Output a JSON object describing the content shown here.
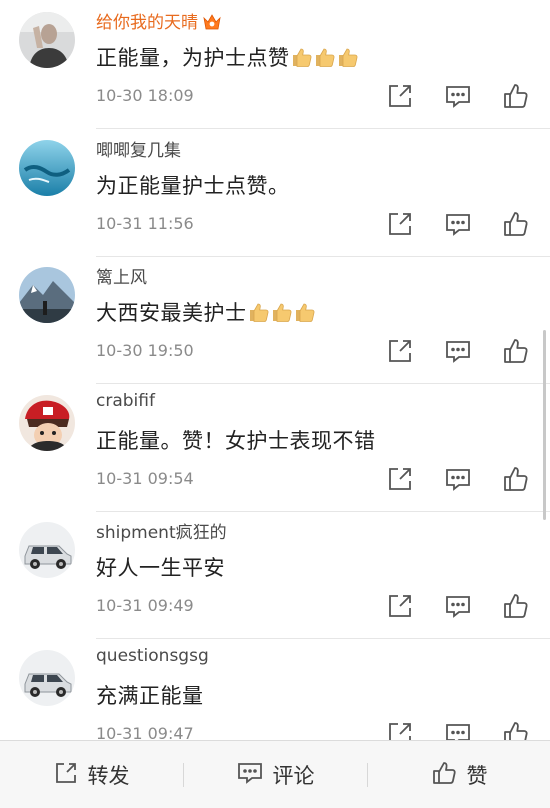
{
  "comments": [
    {
      "username": "给你我的天晴",
      "vip": true,
      "text": "正能量，为护士点赞",
      "thumbs": 3,
      "time": "10-30 18:09",
      "avatar": "man-gesture"
    },
    {
      "username": "唧唧复几集",
      "vip": false,
      "text": "为正能量护士点赞。",
      "thumbs": 0,
      "time": "10-31 11:56",
      "avatar": "water"
    },
    {
      "username": "篱上风",
      "vip": false,
      "text": "大西安最美护士",
      "thumbs": 3,
      "time": "10-30 19:50",
      "avatar": "mountain"
    },
    {
      "username": "crabifif",
      "vip": false,
      "text": "正能量。赞！女护士表现不错",
      "thumbs": 0,
      "time": "10-31 09:54",
      "avatar": "anime"
    },
    {
      "username": "shipment疯狂的",
      "vip": false,
      "text": "好人一生平安",
      "thumbs": 0,
      "time": "10-31 09:49",
      "avatar": "car"
    },
    {
      "username": "questionsgsg",
      "vip": false,
      "text": "充满正能量",
      "thumbs": 0,
      "time": "10-31 09:47",
      "avatar": "car"
    }
  ],
  "bottom_bar": {
    "repost_label": "转发",
    "comment_label": "评论",
    "like_label": "赞"
  },
  "colors": {
    "vip_name": "#e86b1f",
    "text": "#222222",
    "meta": "#8a8a8a",
    "icon": "#555555"
  }
}
